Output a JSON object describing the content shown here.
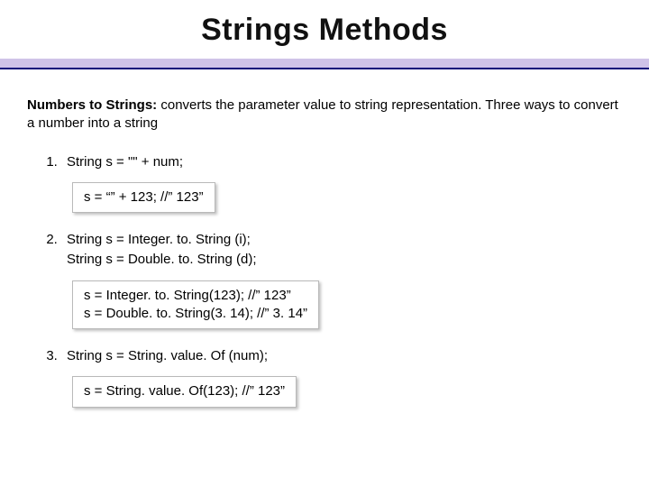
{
  "title": "Strings Methods",
  "intro": {
    "lead": "Numbers to Strings:",
    "rest": " converts the parameter value to string representation. Three ways to convert a number into a string"
  },
  "steps": [
    {
      "lines": [
        "String s = \"\" + num;"
      ],
      "example": "s = “” + 123; //” 123”"
    },
    {
      "lines": [
        "String s = Integer. to. String (i);",
        "String s = Double. to. String (d);"
      ],
      "example": "s = Integer. to. String(123); //” 123”\ns = Double. to. String(3. 14); //” 3. 14”"
    },
    {
      "lines": [
        "String s = String. value. Of (num);"
      ],
      "example": "s = String. value. Of(123); //” 123”"
    }
  ]
}
